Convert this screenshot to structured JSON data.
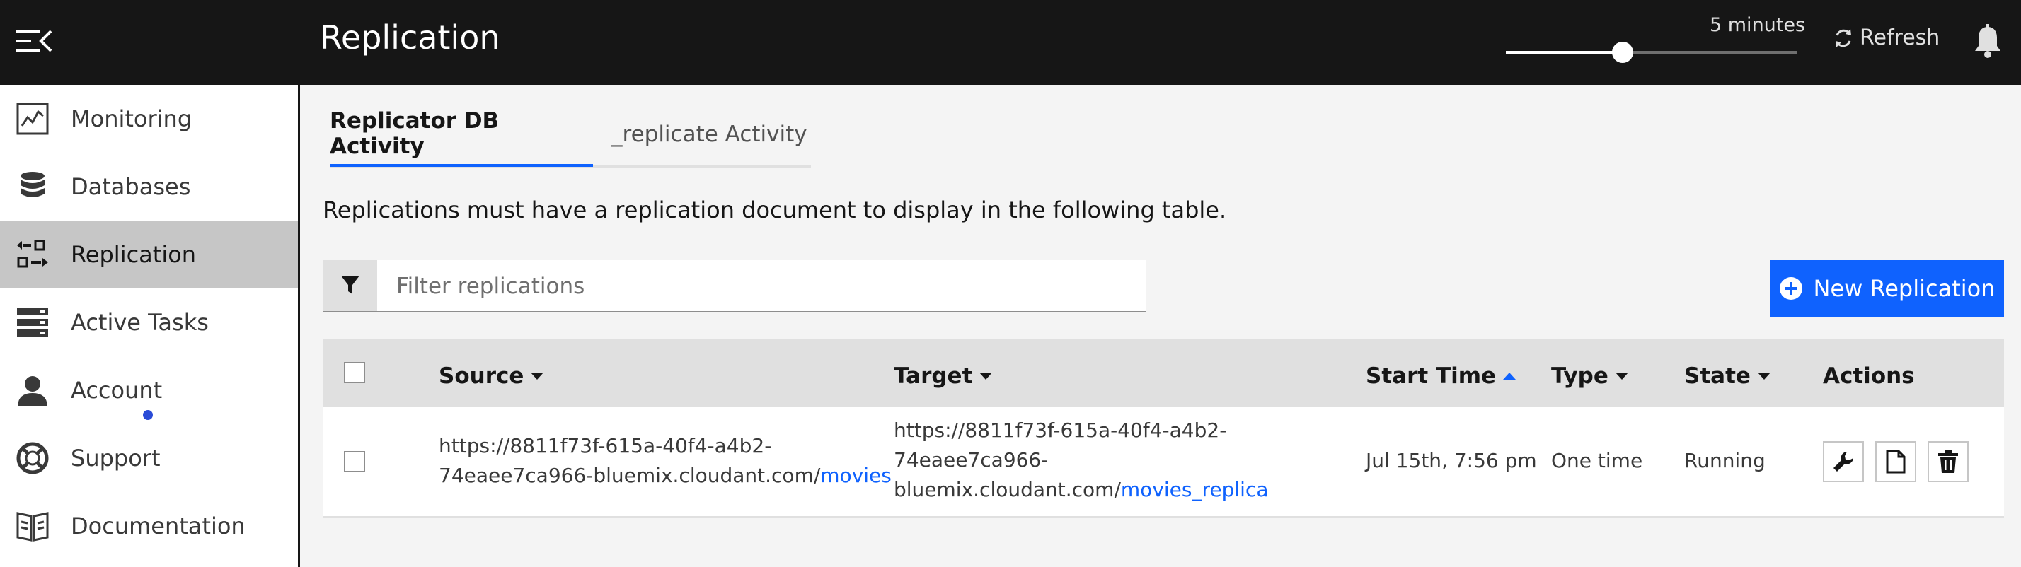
{
  "header": {
    "title": "Replication",
    "polling_label": "5 minutes",
    "polling_fraction": 0.4,
    "refresh_label": "Refresh"
  },
  "sidebar": {
    "items": [
      {
        "label": "Monitoring",
        "icon": "monitoring-icon"
      },
      {
        "label": "Databases",
        "icon": "database-icon"
      },
      {
        "label": "Replication",
        "icon": "replication-icon",
        "active": true
      },
      {
        "label": "Active Tasks",
        "icon": "active-tasks-icon"
      },
      {
        "label": "Account",
        "icon": "account-icon"
      },
      {
        "label": "Support",
        "icon": "support-icon"
      },
      {
        "label": "Documentation",
        "icon": "documentation-icon"
      }
    ]
  },
  "tabs": [
    {
      "label": "Replicator DB Activity",
      "active": true
    },
    {
      "label": "_replicate Activity",
      "active": false
    }
  ],
  "info_text": "Replications must have a replication document to display in the following table.",
  "filter": {
    "placeholder": "Filter replications"
  },
  "new_button": {
    "label": "New Replication"
  },
  "table": {
    "columns": {
      "source": "Source",
      "target": "Target",
      "start_time": "Start Time",
      "type": "Type",
      "state": "State",
      "actions": "Actions"
    },
    "rows": [
      {
        "source_prefix_1": "https://8811f73f-615a-40f4-a4b2-",
        "source_prefix_2": "74eaee7ca966-bluemix.cloudant.com/",
        "source_db": "movies",
        "target_prefix_1": "https://8811f73f-615a-40f4-a4b2-",
        "target_prefix_2": "74eaee7ca966-",
        "target_prefix_3": "bluemix.cloudant.com/",
        "target_db": "movies_replica",
        "start_time": "Jul 15th, 7:56 pm",
        "type": "One time",
        "state": "Running"
      }
    ]
  },
  "colors": {
    "topbar": "#161616",
    "accent": "#0f62fe",
    "sidebar_active": "#c6c6c6"
  }
}
